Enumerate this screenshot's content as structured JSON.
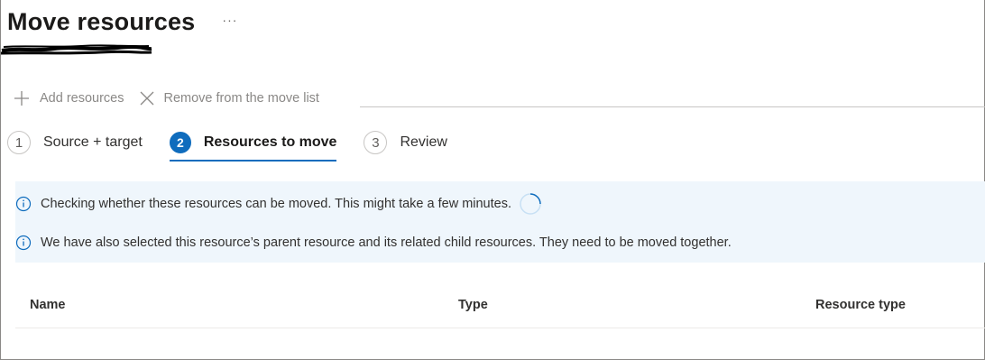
{
  "header": {
    "title": "Move resources",
    "more_label": "···"
  },
  "toolbar": {
    "add_label": "Add resources",
    "remove_label": "Remove from the move list"
  },
  "steps": [
    {
      "number": "1",
      "label": "Source + target",
      "active": false
    },
    {
      "number": "2",
      "label": "Resources to move",
      "active": true
    },
    {
      "number": "3",
      "label": "Review",
      "active": false
    }
  ],
  "info": {
    "checking_text": "Checking whether these resources can be moved. This might take a few minutes.",
    "parent_text": "We have also selected this resource’s parent resource and its related child resources. They need to be moved together."
  },
  "table": {
    "columns": [
      "Name",
      "Type",
      "Resource type"
    ]
  },
  "colors": {
    "accent": "#0f6cbd",
    "info_background": "#eff6fc"
  }
}
